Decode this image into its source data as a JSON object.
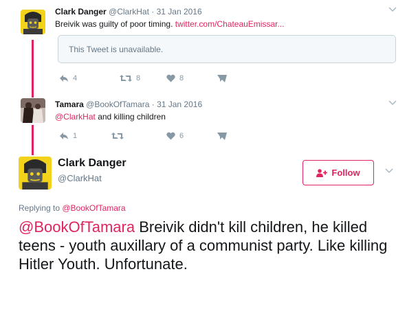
{
  "tweet1": {
    "name": "Clark Danger",
    "handle": "@ClarkHat",
    "separator": "·",
    "date": "31 Jan 2016",
    "text": "Breivik was guilty of poor timing.",
    "link": "twitter.com/ChateauEmissar...",
    "quote_text": "This Tweet is unavailable.",
    "actions": {
      "reply": "4",
      "retweet": "8",
      "like": "8"
    }
  },
  "tweet2": {
    "name": "Tamara",
    "handle": "@BookOfTamara",
    "separator": "·",
    "date": "31 Jan 2016",
    "mention": "@ClarkHat",
    "text": "and killing children",
    "actions": {
      "reply": "1",
      "retweet": "",
      "like": "6"
    }
  },
  "main": {
    "name": "Clark Danger",
    "handle": "@ClarkHat",
    "follow_label": "Follow",
    "replying_prefix": "Replying to ",
    "replying_handle": "@BookOfTamara",
    "mention": "@BookOfTamara",
    "text": "Breivik didn't kill children, he killed teens - youth auxillary of a communist party. Like killing Hitler Youth. Unfortunate."
  },
  "colors": {
    "accent": "#e0245e",
    "text": "#14171a",
    "muted": "#657786",
    "icon": "#8899a6",
    "quote_bg": "#f5f8fa"
  },
  "icons": [
    "reply-icon",
    "retweet-icon",
    "heart-icon",
    "dm-icon",
    "chevron-down-icon",
    "add-user-icon"
  ]
}
